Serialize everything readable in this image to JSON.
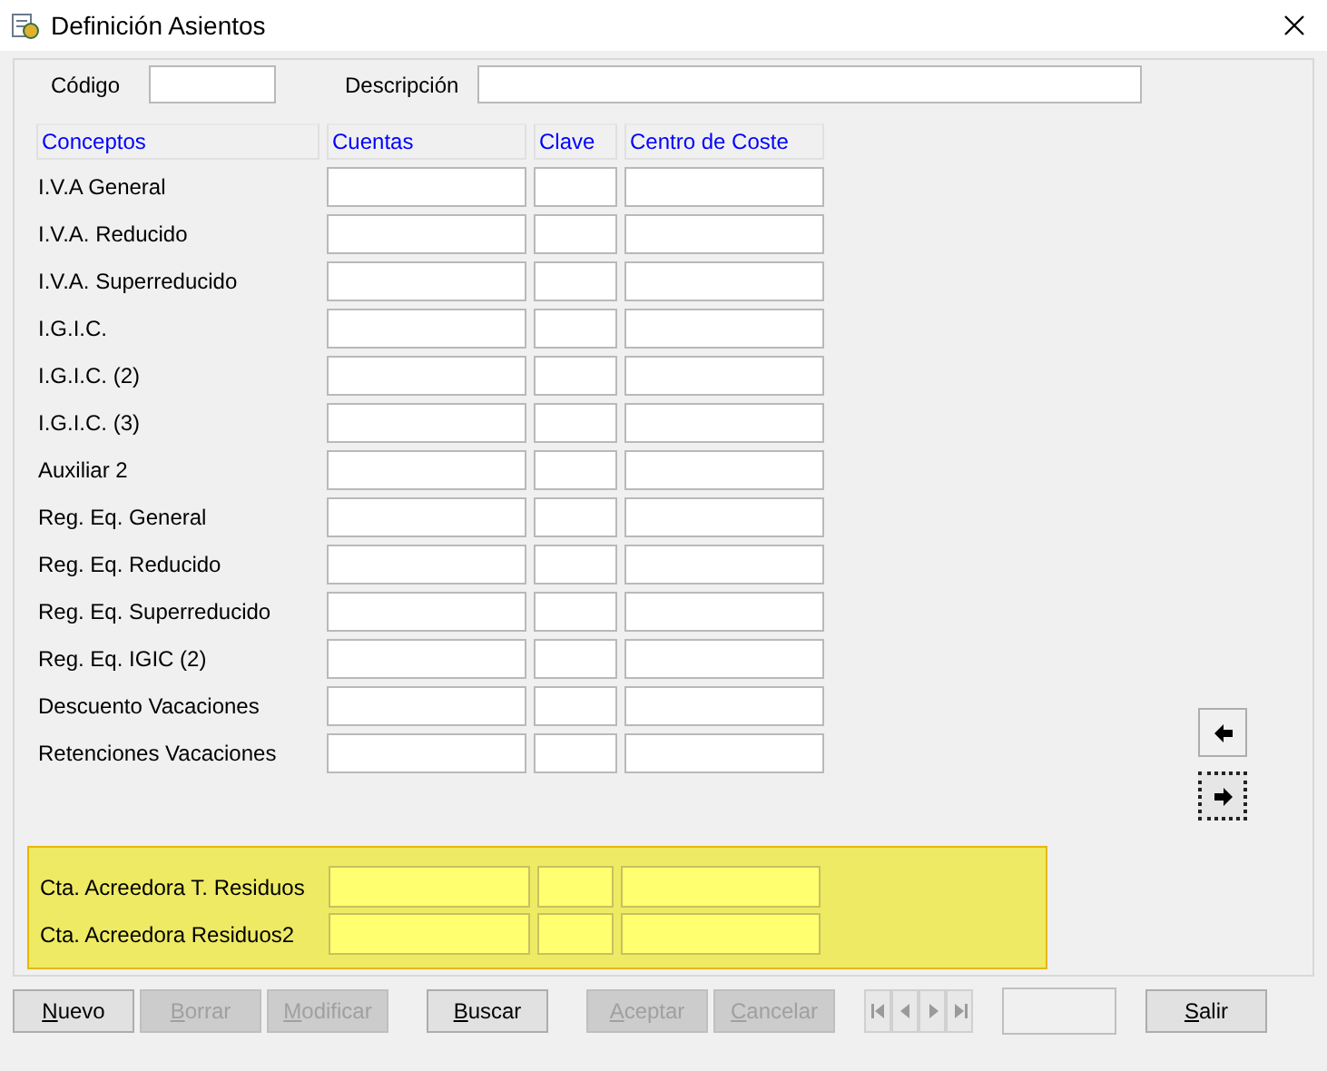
{
  "window": {
    "title": "Definición Asientos"
  },
  "header_fields": [
    {
      "label": "Código",
      "kind": "short"
    },
    {
      "label": "Descripción",
      "kind": "long"
    }
  ],
  "columns": [
    "Conceptos",
    "Cuentas",
    "Clave",
    "Centro de Coste"
  ],
  "rows": [
    {
      "label": "I.V.A General"
    },
    {
      "label": "I.V.A. Reducido"
    },
    {
      "label": "I.V.A. Superreducido"
    },
    {
      "label": "I.G.I.C."
    },
    {
      "label": "I.G.I.C. (2)"
    },
    {
      "label": "I.G.I.C. (3)"
    },
    {
      "label": "Auxiliar 2"
    },
    {
      "label": "Reg. Eq. General"
    },
    {
      "label": "Reg. Eq. Reducido"
    },
    {
      "label": "Reg. Eq. Superreducido"
    },
    {
      "label": "Reg. Eq. IGIC (2)"
    },
    {
      "label": "Descuento Vacaciones"
    },
    {
      "label": "Retenciones Vacaciones"
    }
  ],
  "side_buttons": [
    {
      "kind": "left",
      "focused": false
    },
    {
      "kind": "right",
      "focused": true
    }
  ],
  "highlighted_rows": [
    {
      "label": "Cta. Acreedora T. Residuos"
    },
    {
      "label": "Cta. Acreedora Residuos2"
    }
  ],
  "button_groups": [
    [
      {
        "label": "Nuevo",
        "disabled": false
      },
      {
        "label": "Borrar",
        "disabled": true
      },
      {
        "label": "Modificar",
        "disabled": true
      }
    ],
    [
      {
        "label": "Buscar",
        "disabled": false
      }
    ],
    [
      {
        "label": "Aceptar",
        "disabled": true
      },
      {
        "label": "Cancelar",
        "disabled": true
      }
    ]
  ],
  "record_nav": {
    "disabled": true
  },
  "exit_button": {
    "label": "Salir",
    "disabled": false
  }
}
